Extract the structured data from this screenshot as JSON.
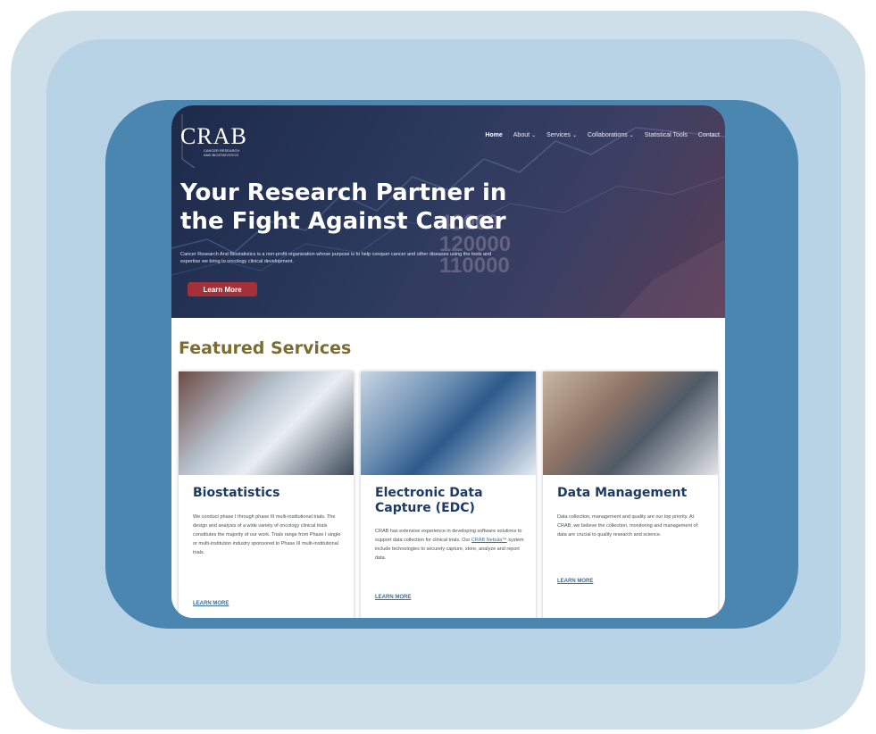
{
  "colors": {
    "accent_button": "#a53138",
    "featured_title": "#7a6d2f",
    "card_title": "#1c3a66",
    "link": "#3d6e9c"
  },
  "logo": {
    "main": "CRAB",
    "sub_line1": "CANCER RESEARCH",
    "sub_line2": "AND BIOSTATISTICS"
  },
  "nav": {
    "items": [
      {
        "label": "Home",
        "active": true,
        "dropdown": false
      },
      {
        "label": "About",
        "dropdown": true
      },
      {
        "label": "Services",
        "dropdown": true
      },
      {
        "label": "Collaborations",
        "dropdown": true
      },
      {
        "label": "Statistical Tools",
        "dropdown": false
      },
      {
        "label": "Contact",
        "dropdown": false
      }
    ],
    "caret_icon": "chevron-down-icon"
  },
  "hero": {
    "title_line1": "Your Research Partner in",
    "title_line2": "the Fight Against Cancer",
    "description": "Cancer Research And Biostatistics is a non-profit organization whose purpose is to help conquer cancer and other diseases using the tools and expertise we bring to oncology clinical development.",
    "button_label": "Learn More",
    "background_numbers": [
      "40000",
      "120000",
      "110000"
    ]
  },
  "featured": {
    "title": "Featured Services",
    "cards": [
      {
        "title": "Biostatistics",
        "description": "We conduct phase I through phase III multi-institutional trials. The design and analysis of a wide variety of oncology clinical trials constitutes the majority of our work. Trials range from Phase I single or multi-institution industry sponsored to Phase III multi-institutional trials.",
        "link": "LEARN MORE"
      },
      {
        "title": "Electronic Data Capture (EDC)",
        "description_before": "CRAB has extensive experience in developing software solutions to support data collection for clinical trials. Our ",
        "description_link": "CRAB Nebula™",
        "description_after": " system include technologies to securely capture, store, analyze and report data.",
        "link": "LEARN MORE"
      },
      {
        "title": "Data Management",
        "description": "Data collection, management and quality are our top priority. At CRAB, we believe the collection, monitoring and management of data are crucial to quality research and science.",
        "link": "LEARN MORE"
      }
    ]
  }
}
